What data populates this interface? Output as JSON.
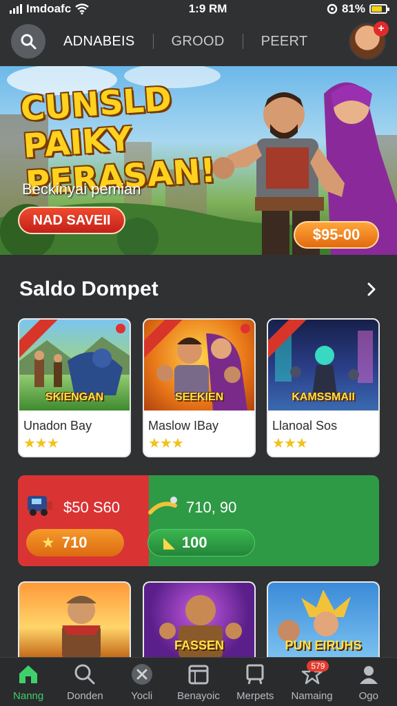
{
  "status_bar": {
    "carrier": "Imdoafc",
    "time": "1:9 RM",
    "battery": "81%",
    "battery_level": 0.81
  },
  "top_nav": {
    "tabs": [
      {
        "label": "ADNABEIS",
        "active": true
      },
      {
        "label": "GROOD",
        "active": false
      },
      {
        "label": "PEERT",
        "active": false
      }
    ],
    "avatar_badge": "+"
  },
  "banner": {
    "title": "CUNSLD PAIKY PERASAN!",
    "subtitle": "Beckinyai pemian",
    "cta": "NAD SAVEII",
    "price": "$95-00"
  },
  "section": {
    "title": "Saldo Dompet",
    "more_icon": "chevron-right-icon"
  },
  "games": [
    {
      "art_label": "SKIENGAN",
      "name": "Unadon Bay",
      "stars": "★★★"
    },
    {
      "art_label": "SEEKIEN",
      "name": "Maslow IBay",
      "stars": "★★★"
    },
    {
      "art_label": "KAMSSMAII",
      "name": "Llanoal Sos",
      "stars": "★★★"
    }
  ],
  "wallet": {
    "left_amount": "$50 S60",
    "right_amount": "710, 90",
    "left_button": "710",
    "right_button": "100",
    "colors": {
      "left": "#d93334",
      "right": "#2f9a46"
    }
  },
  "bottom_games": [
    {
      "art_label": ""
    },
    {
      "art_label": "FASSEN"
    },
    {
      "art_label": "PUN EIRUHS"
    }
  ],
  "bottom_nav": [
    {
      "label": "Nanng",
      "icon": "home-icon",
      "active": true
    },
    {
      "label": "Donden",
      "icon": "search-icon"
    },
    {
      "label": "Yocli",
      "icon": "close-circle-icon"
    },
    {
      "label": "Benayoic",
      "icon": "calendar-icon"
    },
    {
      "label": "Merpets",
      "icon": "board-icon"
    },
    {
      "label": "Namaing",
      "icon": "star-icon",
      "badge": "579"
    },
    {
      "label": "Ogo",
      "icon": "profile-icon"
    }
  ]
}
